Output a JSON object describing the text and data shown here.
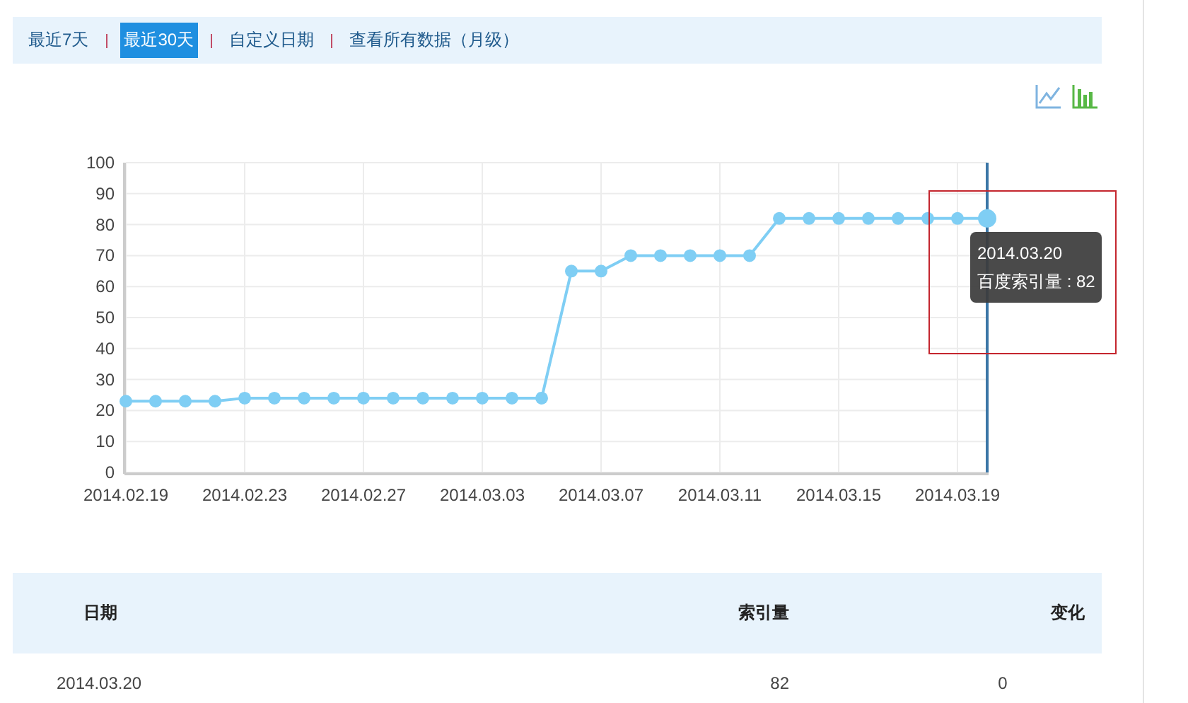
{
  "tabs": [
    {
      "label": "最近7天",
      "selected": false
    },
    {
      "label": "最近30天",
      "selected": true
    },
    {
      "label": "自定义日期",
      "selected": false
    },
    {
      "label": "查看所有数据（月级）",
      "selected": false
    }
  ],
  "chart_switch": [
    {
      "kind": "line"
    },
    {
      "kind": "bar"
    }
  ],
  "chart": {
    "tooltip": {
      "date": "2014.03.20",
      "label": "百度索引量 : 82"
    },
    "chart_data": {
      "type": "line",
      "grid": true,
      "categories": [
        "2014.02.19",
        null,
        null,
        null,
        "2014.02.23",
        null,
        null,
        null,
        "2014.02.27",
        null,
        null,
        null,
        "2014.03.03",
        null,
        null,
        null,
        "2014.03.07",
        null,
        null,
        null,
        "2014.03.11",
        null,
        null,
        null,
        "2014.03.15",
        null,
        null,
        null,
        "2014.03.19",
        null
      ],
      "series": [
        {
          "color": "#7fcef4",
          "marker": true,
          "values": [
            23,
            23,
            23,
            23,
            24,
            24,
            24,
            24,
            24,
            24,
            24,
            24,
            24,
            24,
            24,
            65,
            65,
            70,
            70,
            70,
            70,
            70,
            82,
            82,
            82,
            82,
            82,
            82,
            82,
            82
          ]
        }
      ],
      "ylim": [
        0,
        100
      ],
      "yticks": [
        0,
        10,
        20,
        30,
        40,
        50,
        60,
        70,
        80,
        90,
        100
      ]
    }
  },
  "table": {
    "columns": [
      "日期",
      "索引量",
      "变化"
    ],
    "rows": [
      [
        "2014.03.20",
        "82",
        "0"
      ]
    ]
  }
}
